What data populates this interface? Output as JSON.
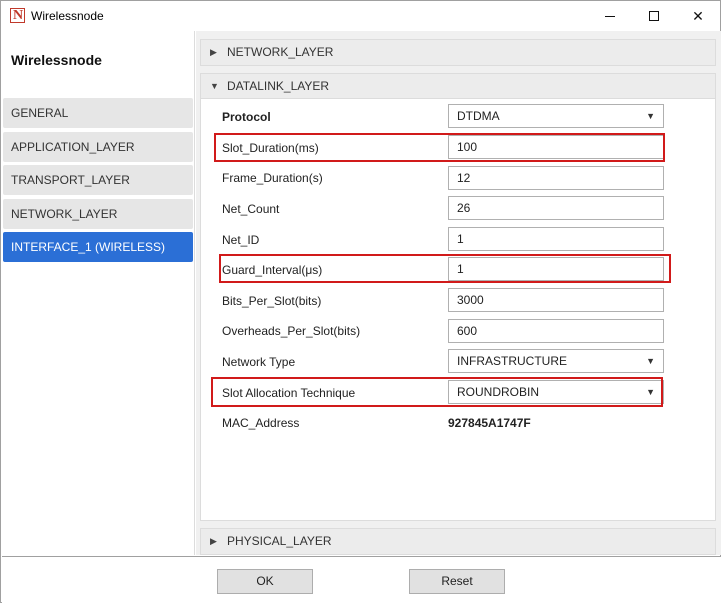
{
  "window": {
    "title": "Wirelessnode",
    "app_icon_letter": "N",
    "minimize_icon": "minimize-icon",
    "maximize_icon": "maximize-icon",
    "close_glyph": "✕"
  },
  "sidebar": {
    "title": "Wirelessnode",
    "items": [
      {
        "label": "GENERAL",
        "active": false
      },
      {
        "label": "APPLICATION_LAYER",
        "active": false
      },
      {
        "label": "TRANSPORT_LAYER",
        "active": false
      },
      {
        "label": "NETWORK_LAYER",
        "active": false
      },
      {
        "label": "INTERFACE_1 (WIRELESS)",
        "active": true
      }
    ]
  },
  "sections": {
    "network_layer": {
      "label": "NETWORK_LAYER",
      "expanded": false
    },
    "datalink_layer": {
      "label": "DATALINK_LAYER",
      "expanded": true
    },
    "physical_layer": {
      "label": "PHYSICAL_LAYER",
      "expanded": false
    }
  },
  "datalink": {
    "protocol": {
      "label": "Protocol",
      "value": "DTDMA"
    },
    "slot_duration": {
      "label": "Slot_Duration(ms)",
      "value": "100"
    },
    "frame_duration": {
      "label": "Frame_Duration(s)",
      "value": "12"
    },
    "net_count": {
      "label": "Net_Count",
      "value": "26"
    },
    "net_id": {
      "label": "Net_ID",
      "value": "1"
    },
    "guard_interval": {
      "label": "Guard_Interval(μs)",
      "value": "1"
    },
    "bits_per_slot": {
      "label": "Bits_Per_Slot(bits)",
      "value": "3000"
    },
    "overheads_per_slot": {
      "label": "Overheads_Per_Slot(bits)",
      "value": "600"
    },
    "network_type": {
      "label": "Network Type",
      "value": "INFRASTRUCTURE"
    },
    "slot_allocation": {
      "label": "Slot Allocation Technique",
      "value": "ROUNDROBIN"
    },
    "mac_address": {
      "label": "MAC_Address",
      "value": "927845A1747F"
    }
  },
  "footer": {
    "ok_label": "OK",
    "reset_label": "Reset"
  },
  "colors": {
    "accent": "#2b6fd6",
    "highlight": "#d11a1a"
  }
}
